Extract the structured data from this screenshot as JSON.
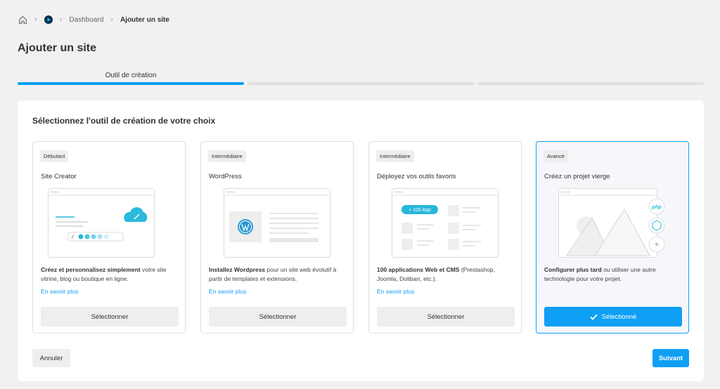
{
  "breadcrumb": {
    "items": [
      "Dashboard",
      "Ajouter un site"
    ],
    "sep": "›"
  },
  "page": {
    "title": "Ajouter un site"
  },
  "steps": {
    "active_label": "Outil de création"
  },
  "panel": {
    "title": "Sélectionnez l'outil de création de votre choix"
  },
  "cards": [
    {
      "badge": "Débutant",
      "name": "Site Creator",
      "desc_bold": "Créez et personnalisez simplement",
      "desc_rest": " votre site vitrine, blog ou boutique en ligne.",
      "link": "En savoir plus",
      "button": "Sélectionner"
    },
    {
      "badge": "Intermédiaire",
      "name": "WordPress",
      "desc_bold": "Installez Wordpress",
      "desc_rest": " pour un site web évolutif à partir de templates et extensions.",
      "link": "En savoir plus",
      "button": "Sélectionner"
    },
    {
      "badge": "Intermédiaire",
      "name": "Déployez vos outils favoris",
      "desc_bold": "100 applications Web et CMS",
      "desc_rest": " (Prestashop, Joomla, Dolibarr, etc.).",
      "link": "En savoir plus",
      "button": "Sélectionner",
      "illus_pill": "+ 100 App"
    },
    {
      "badge": "Avancé",
      "name": "Créez un projet vierge",
      "desc_bold": "Configurer plus tard",
      "desc_rest": " ou utiliser une autre technologie pour votre projet.",
      "button": "Sélectionné",
      "illus_php": "php",
      "illus_plus": "+"
    }
  ],
  "actions": {
    "cancel": "Annuler",
    "next": "Suivant"
  },
  "colors": {
    "accent": "#0f9ff5",
    "page_bg": "#f1f1f1",
    "panel_bg": "#ffffff",
    "selected_card_bg": "#f5f7fb"
  }
}
